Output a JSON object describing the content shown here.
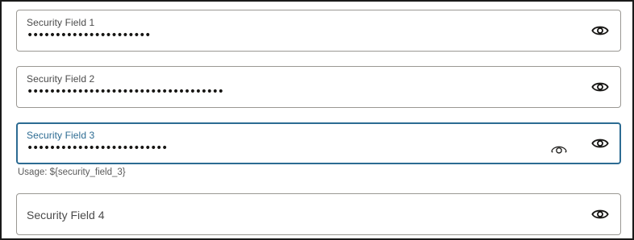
{
  "fields": [
    {
      "label": "Security Field 1",
      "value": "••••••••••••••••••••••"
    },
    {
      "label": "Security Field 2",
      "value": "•••••••••••••••••••••••••••••••••••"
    },
    {
      "label": "Security Field 3",
      "value": "•••••••••••••••••••••••••"
    },
    {
      "label": "Security Field 4",
      "value": ""
    }
  ],
  "usage_text": "Usage: ${security_field_3}",
  "icons": {
    "reveal": "eye-icon",
    "hover_reveal": "eye-outline-icon"
  },
  "colors": {
    "focus": "#2c6b92",
    "border": "#9a9893",
    "label": "#4a4a4a"
  }
}
